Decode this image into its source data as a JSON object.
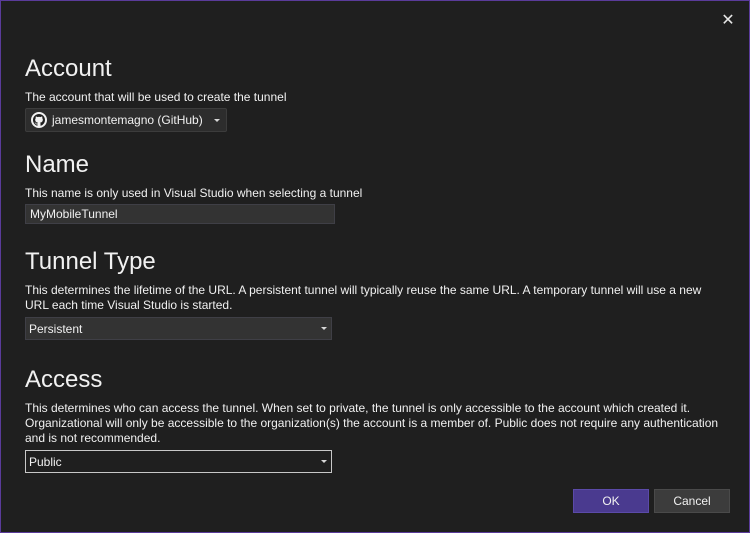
{
  "dialog": {
    "close_glyph": "✕"
  },
  "account": {
    "title": "Account",
    "description": "The account that will be used to create the tunnel",
    "selected": "jamesmontemagno (GitHub)",
    "icon": "github-icon"
  },
  "name": {
    "title": "Name",
    "description": "This name is only used in Visual Studio when selecting a tunnel",
    "value": "MyMobileTunnel"
  },
  "tunnel_type": {
    "title": "Tunnel Type",
    "description": "This determines the lifetime of the URL. A persistent tunnel will typically reuse the same URL. A temporary tunnel will use a new URL each time Visual Studio is started.",
    "selected": "Persistent"
  },
  "access": {
    "title": "Access",
    "description": "This determines who can access the tunnel. When set to private, the tunnel is only accessible to the account which created it. Organizational will only be accessible to the organization(s) the account is a member of. Public does not require any authentication and is not recommended.",
    "selected": "Public"
  },
  "buttons": {
    "ok": "OK",
    "cancel": "Cancel"
  },
  "colors": {
    "accent": "#4a3a8f",
    "background": "#1f1f1f",
    "border": "#5a3b9a"
  }
}
